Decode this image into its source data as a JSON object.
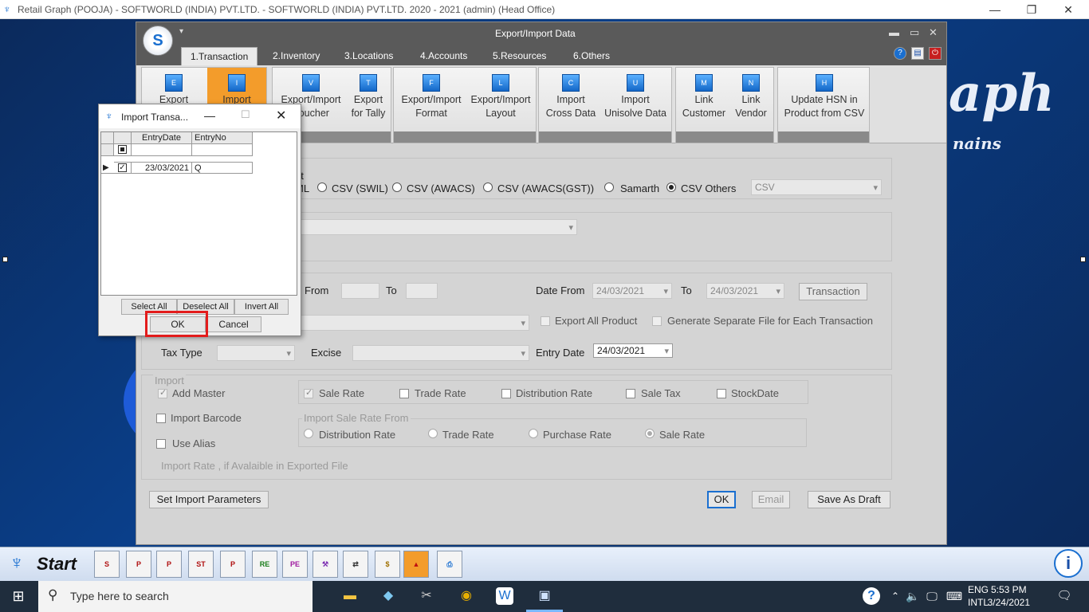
{
  "os_title": "Retail Graph (POOJA) - SOFTWORLD (INDIA) PVT.LTD. - SOFTWORLD (INDIA) PVT.LTD.  2020 - 2021 (admin) (Head Office)",
  "bg": {
    "logo": "aph",
    "sub": "nains"
  },
  "main_window": {
    "title": "Export/Import Data",
    "tabs": [
      "1.Transaction",
      "2.Inventory",
      "3.Locations",
      "4.Accounts",
      "5.Resources",
      "6.Others"
    ],
    "ribbon": {
      "export": "Export",
      "import": "Import",
      "export_import_voucher": [
        "Export/Import",
        "Voucher"
      ],
      "export_tally": [
        "Export",
        "for Tally"
      ],
      "export_import_format": [
        "Export/Import",
        "Format"
      ],
      "export_import_layout": [
        "Export/Import",
        "Layout"
      ],
      "import_cross": [
        "Import",
        "Cross Data"
      ],
      "import_unisolve": [
        "Import",
        "Unisolve Data"
      ],
      "link_customer": [
        "Link",
        "Customer"
      ],
      "link_vendor": [
        "Link",
        "Vendor"
      ],
      "update_hsn": [
        "Update HSN in",
        "Product from CSV"
      ]
    },
    "format": {
      "label_tail": "at",
      "opt_xml_tail": "ML",
      "opt_csv_swil": "CSV (SWIL)",
      "opt_csv_awacs": "CSV (AWACS)",
      "opt_csv_awacs_gst": "CSV (AWACS(GST))",
      "opt_samarth": "Samarth",
      "opt_csv_others": "CSV Others",
      "format_select": "CSV"
    },
    "filters": {
      "from": "From",
      "to": "To",
      "date_from": "Date From",
      "date_from_value": "24/03/2021",
      "date_to": "To",
      "date_to_value": "24/03/2021",
      "transaction_btn": "Transaction",
      "export_all_product": "Export All Product",
      "generate_separate": "Generate Separate File for Each Transaction",
      "tax_type": "Tax Type",
      "excise": "Excise",
      "entry_date": "Entry Date",
      "entry_date_value": "24/03/2021"
    },
    "import": {
      "legend": "Import",
      "add_master": "Add Master",
      "import_barcode": "Import Barcode",
      "use_alias": "Use Alias",
      "sale_rate": "Sale Rate",
      "trade_rate": "Trade Rate",
      "distribution_rate": "Distribution Rate",
      "sale_tax": "Sale Tax",
      "stock_date": "StockDate",
      "sale_rate_from_legend": "Import Sale Rate From",
      "r_distribution": "Distribution Rate",
      "r_trade": "Trade Rate",
      "r_purchase": "Purchase Rate",
      "r_sale": "Sale Rate",
      "import_rate_note": "Import Rate , if Avalaible in Exported File"
    },
    "buttons": {
      "set_params": "Set Import Parameters",
      "ok": "OK",
      "email": "Email",
      "save_draft": "Save As Draft"
    }
  },
  "dialog": {
    "title": "Import Transa...",
    "columns": [
      "EntryDate",
      "EntryNo"
    ],
    "rows": [
      {
        "date": "23/03/2021",
        "no": "Q",
        "checked": true
      }
    ],
    "select_all": "Select All",
    "deselect_all": "Deselect All",
    "invert_all": "Invert All",
    "ok": "OK",
    "cancel": "Cancel"
  },
  "app_taskbar": {
    "start": "Start"
  },
  "win_taskbar": {
    "search_placeholder": "Type here to search",
    "lang1": "ENG",
    "lang2": "INTL",
    "time": "5:53 PM",
    "date": "3/24/2021"
  }
}
